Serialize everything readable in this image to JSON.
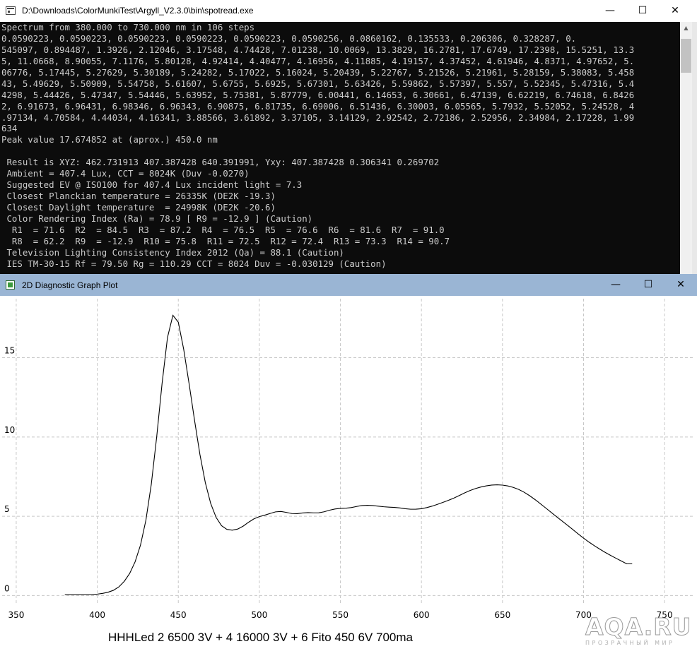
{
  "console_window": {
    "title": "D:\\Downloads\\ColorMunkiTest\\Argyll_V2.3.0\\bin\\spotread.exe",
    "minimize": "—",
    "maximize": "☐",
    "close": "✕",
    "lines": [
      "Spectrum from 380.000 to 730.000 nm in 106 steps",
      "0.0590223, 0.0590223, 0.0590223, 0.0590223, 0.0590223, 0.0590256, 0.0860162, 0.135533, 0.206306, 0.328287, 0.",
      "545097, 0.894487, 1.3926, 2.12046, 3.17548, 4.74428, 7.01238, 10.0069, 13.3829, 16.2781, 17.6749, 17.2398, 15.5251, 13.3",
      "5, 11.0668, 8.90055, 7.1176, 5.80128, 4.92414, 4.40477, 4.16956, 4.11885, 4.19157, 4.37452, 4.61946, 4.8371, 4.97652, 5.",
      "06776, 5.17445, 5.27629, 5.30189, 5.24282, 5.17022, 5.16024, 5.20439, 5.22767, 5.21526, 5.21961, 5.28159, 5.38083, 5.458",
      "43, 5.49629, 5.50909, 5.54758, 5.61607, 5.6755, 5.6925, 5.67301, 5.63426, 5.59862, 5.57397, 5.557, 5.52345, 5.47316, 5.4",
      "4298, 5.44426, 5.47347, 5.54446, 5.63952, 5.75381, 5.87779, 6.00441, 6.14653, 6.30661, 6.47139, 6.62219, 6.74618, 6.8426",
      "2, 6.91673, 6.96431, 6.98346, 6.96343, 6.90875, 6.81735, 6.69006, 6.51436, 6.30003, 6.05565, 5.7932, 5.52052, 5.24528, 4",
      ".97134, 4.70584, 4.44034, 4.16341, 3.88566, 3.61892, 3.37105, 3.14129, 2.92542, 2.72186, 2.52956, 2.34984, 2.17228, 1.99",
      "634",
      "Peak value 17.674852 at (aprox.) 450.0 nm",
      "",
      " Result is XYZ: 462.731913 407.387428 640.391991, Yxy: 407.387428 0.306341 0.269702",
      " Ambient = 407.4 Lux, CCT = 8024K (Duv -0.0270)",
      " Suggested EV @ ISO100 for 407.4 Lux incident light = 7.3",
      " Closest Planckian temperature = 26335K (DE2K -19.3)",
      " Closest Daylight temperature  = 24998K (DE2K -20.6)",
      " Color Rendering Index (Ra) = 78.9 [ R9 = -12.9 ] (Caution)",
      "  R1  = 71.6  R2  = 84.5  R3  = 87.2  R4  = 76.5  R5  = 76.6  R6  = 81.6  R7  = 91.0",
      "  R8  = 62.2  R9  = -12.9  R10 = 75.8  R11 = 72.5  R12 = 72.4  R13 = 73.3  R14 = 90.7",
      " Television Lighting Consistency Index 2012 (Qa) = 88.1 (Caution)",
      " IES TM-30-15 Rf = 79.50 Rg = 110.29 CCT = 8024 Duv = -0.030129 (Caution)"
    ]
  },
  "graph_window": {
    "title": "2D Diagnostic Graph Plot",
    "minimize": "—",
    "maximize": "☐",
    "close": "✕"
  },
  "chart_data": {
    "type": "line",
    "title": "",
    "xlabel": "",
    "ylabel": "",
    "xlim": [
      340,
      770
    ],
    "ylim": [
      -1.5,
      18.9
    ],
    "x_ticks": [
      350,
      400,
      450,
      500,
      550,
      600,
      650,
      700,
      750
    ],
    "y_ticks": [
      0,
      5,
      10,
      15
    ],
    "grid": true,
    "series": [
      {
        "color": "#000000",
        "x_start": 380,
        "x_step": 3.3333333,
        "values": [
          0.0590223,
          0.0590223,
          0.0590223,
          0.0590223,
          0.0590223,
          0.0590256,
          0.0860162,
          0.135533,
          0.206306,
          0.328287,
          0.545097,
          0.894487,
          1.3926,
          2.12046,
          3.17548,
          4.74428,
          7.01238,
          10.0069,
          13.3829,
          16.2781,
          17.6749,
          17.2398,
          15.5251,
          13.35,
          11.0668,
          8.90055,
          7.1176,
          5.80128,
          4.92414,
          4.40477,
          4.16956,
          4.11885,
          4.19157,
          4.37452,
          4.61946,
          4.8371,
          4.97652,
          5.06776,
          5.17445,
          5.27629,
          5.30189,
          5.24282,
          5.17022,
          5.16024,
          5.20439,
          5.22767,
          5.21526,
          5.21961,
          5.28159,
          5.38083,
          5.45843,
          5.49629,
          5.50909,
          5.54758,
          5.61607,
          5.6755,
          5.6925,
          5.67301,
          5.63426,
          5.59862,
          5.57397,
          5.557,
          5.52345,
          5.47316,
          5.44298,
          5.44426,
          5.47347,
          5.54446,
          5.63952,
          5.75381,
          5.87779,
          6.00441,
          6.14653,
          6.30661,
          6.47139,
          6.62219,
          6.74618,
          6.84262,
          6.91673,
          6.96431,
          6.98346,
          6.96343,
          6.90875,
          6.81735,
          6.69006,
          6.51436,
          6.30003,
          6.05565,
          5.7932,
          5.52052,
          5.24528,
          4.97134,
          4.70584,
          4.44034,
          4.16341,
          3.88566,
          3.61892,
          3.37105,
          3.14129,
          2.92542,
          2.72186,
          2.52956,
          2.34984,
          2.17228,
          1.99634,
          1.99634
        ]
      }
    ]
  },
  "caption": "HHHLed 2 6500 3V + 4 16000 3V + 6 Fito 450 6V  700ma",
  "watermark": {
    "logo": "AQA.RU",
    "tagline": "ПРОЗРАЧНЫЙ МИР"
  }
}
